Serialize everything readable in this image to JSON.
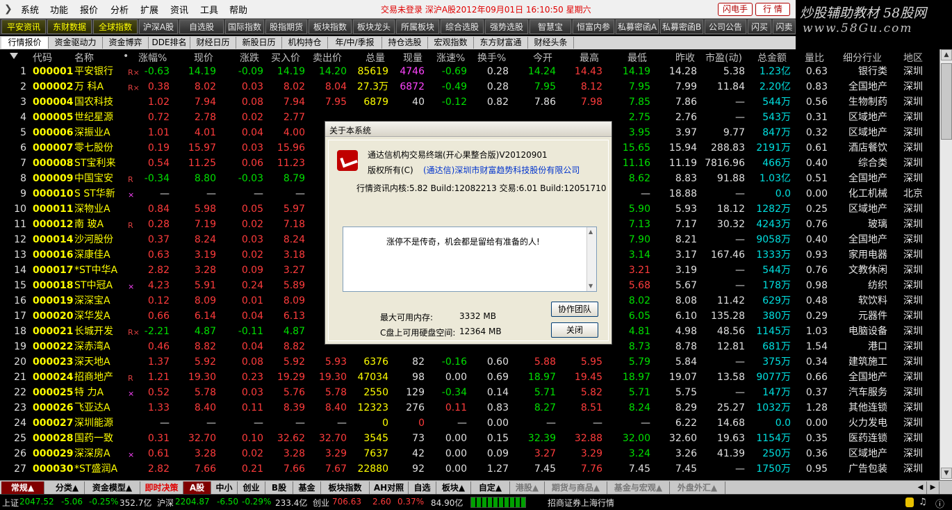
{
  "menubar": {
    "items": [
      "系统",
      "功能",
      "报价",
      "分析",
      "扩展",
      "资讯",
      "工具",
      "帮助"
    ],
    "status": "交易未登录   深沪A股2012年09月01日  16:10:50  星期六",
    "btn_dial": "闪电手",
    "btn_quote": "行  情"
  },
  "logo": {
    "line1": "炒股辅助教材 58股网",
    "line2": "www.58Gu.com"
  },
  "toolbar": {
    "buttons": [
      "平安资讯",
      "东财数据",
      "全球指数",
      "沪深A股",
      "自选股",
      "国际指数",
      "股指期货",
      "板块指数",
      "板块龙头",
      "所属板块",
      "综合选股",
      "强势选股",
      "智慧宝",
      "恒富内参",
      "私募密函A",
      "私募密函B",
      "公司公告",
      "闪买",
      "闪卖"
    ]
  },
  "tabbar": {
    "tabs": [
      "行情报价",
      "资金驱动力",
      "资金博弈",
      "DDE排名",
      "财经日历",
      "新股日历",
      "机构持仓",
      "年/中/季报",
      "持仓选股",
      "宏观指数",
      "东方财富通",
      "财经头条"
    ]
  },
  "table": {
    "headers": [
      "代码",
      "名称",
      "•",
      "涨幅%",
      "现价",
      "涨跌",
      "买入价",
      "卖出价",
      "总量",
      "现量",
      "涨速%",
      "换手%",
      "今开",
      "最高",
      "最低",
      "昨收",
      "市盈(动)",
      "总金额",
      "量比",
      "细分行业",
      "地区"
    ],
    "rows": [
      [
        "1",
        "000001",
        "平安银行",
        "R×",
        "-0.63",
        "14.19",
        "-0.09",
        "14.19",
        "14.20",
        "85619",
        "4746",
        "-0.69",
        "0.28",
        "14.24",
        "14.43",
        "14.19",
        "14.28",
        "5.38",
        "1.23亿",
        "0.63",
        "银行类",
        "深圳"
      ],
      [
        "2",
        "000002",
        "万  科A",
        "R×",
        "0.38",
        "8.02",
        "0.03",
        "8.02",
        "8.04",
        "27.3万",
        "6872",
        "-0.49",
        "0.28",
        "7.95",
        "8.12",
        "7.95",
        "7.99",
        "11.84",
        "2.20亿",
        "0.83",
        "全国地产",
        "深圳"
      ],
      [
        "3",
        "000004",
        "国农科技",
        "",
        "1.02",
        "7.94",
        "0.08",
        "7.94",
        "7.95",
        "6879",
        "40",
        "-0.12",
        "0.82",
        "7.86",
        "7.98",
        "7.85",
        "7.86",
        "—",
        "544万",
        "0.56",
        "生物制药",
        "深圳"
      ],
      [
        "4",
        "000005",
        "世纪星源",
        "",
        "0.72",
        "2.78",
        "0.02",
        "2.77",
        "",
        "",
        "",
        "",
        "",
        "",
        "",
        "2.75",
        "2.76",
        "—",
        "543万",
        "0.31",
        "区域地产",
        "深圳"
      ],
      [
        "5",
        "000006",
        "深振业A",
        "",
        "1.01",
        "4.01",
        "0.04",
        "4.00",
        "",
        "",
        "",
        "",
        "",
        "",
        "",
        "3.95",
        "3.97",
        "9.77",
        "847万",
        "0.32",
        "区域地产",
        "深圳"
      ],
      [
        "6",
        "000007",
        "零七股份",
        "",
        "0.19",
        "15.97",
        "0.03",
        "15.96",
        "",
        "",
        "",
        "",
        "",
        "",
        "",
        "15.65",
        "15.94",
        "288.83",
        "2191万",
        "0.61",
        "酒店餐饮",
        "深圳"
      ],
      [
        "7",
        "000008",
        "ST宝利来",
        "",
        "0.54",
        "11.25",
        "0.06",
        "11.23",
        "",
        "",
        "",
        "",
        "",
        "",
        "",
        "11.16",
        "11.19",
        "7816.96",
        "466万",
        "0.40",
        "综合类",
        "深圳"
      ],
      [
        "8",
        "000009",
        "中国宝安",
        "R",
        "-0.34",
        "8.80",
        "-0.03",
        "8.79",
        "",
        "",
        "",
        "",
        "",
        "",
        "",
        "8.62",
        "8.83",
        "91.88",
        "1.03亿",
        "0.51",
        "全国地产",
        "深圳"
      ],
      [
        "9",
        "000010",
        "S ST华新",
        "×",
        "—",
        "—",
        "—",
        "—",
        "",
        "",
        "",
        "",
        "",
        "",
        "",
        "—",
        "18.88",
        "—",
        "0.0",
        "0.00",
        "化工机械",
        "北京"
      ],
      [
        "10",
        "000011",
        "深物业A",
        "",
        "0.84",
        "5.98",
        "0.05",
        "5.97",
        "",
        "",
        "",
        "",
        "",
        "",
        "",
        "5.90",
        "5.93",
        "18.12",
        "1282万",
        "0.25",
        "区域地产",
        "深圳"
      ],
      [
        "11",
        "000012",
        "南  玻A",
        "R",
        "0.28",
        "7.19",
        "0.02",
        "7.18",
        "",
        "",
        "",
        "",
        "",
        "",
        "",
        "7.13",
        "7.17",
        "30.32",
        "4243万",
        "0.76",
        "玻璃",
        "深圳"
      ],
      [
        "12",
        "000014",
        "沙河股份",
        "",
        "0.37",
        "8.24",
        "0.03",
        "8.24",
        "",
        "",
        "",
        "",
        "",
        "",
        "",
        "7.90",
        "8.21",
        "—",
        "9058万",
        "0.40",
        "全国地产",
        "深圳"
      ],
      [
        "13",
        "000016",
        "深康佳A",
        "",
        "0.63",
        "3.19",
        "0.02",
        "3.18",
        "",
        "",
        "",
        "",
        "",
        "",
        "",
        "3.14",
        "3.17",
        "167.46",
        "1333万",
        "0.93",
        "家用电器",
        "深圳"
      ],
      [
        "14",
        "000017",
        "*ST中华A",
        "",
        "2.82",
        "3.28",
        "0.09",
        "3.27",
        "",
        "",
        "",
        "",
        "",
        "",
        "",
        "3.21",
        "3.19",
        "—",
        "544万",
        "0.76",
        "文教休闲",
        "深圳"
      ],
      [
        "15",
        "000018",
        "ST中冠A",
        "×",
        "4.23",
        "5.91",
        "0.24",
        "5.89",
        "",
        "",
        "",
        "",
        "",
        "",
        "",
        "5.68",
        "5.67",
        "—",
        "178万",
        "0.98",
        "纺织",
        "深圳"
      ],
      [
        "16",
        "000019",
        "深深宝A",
        "",
        "0.12",
        "8.09",
        "0.01",
        "8.09",
        "",
        "",
        "",
        "",
        "",
        "",
        "",
        "8.02",
        "8.08",
        "11.42",
        "629万",
        "0.48",
        "软饮料",
        "深圳"
      ],
      [
        "17",
        "000020",
        "深华发A",
        "",
        "0.66",
        "6.14",
        "0.04",
        "6.13",
        "",
        "",
        "",
        "",
        "",
        "",
        "",
        "6.05",
        "6.10",
        "135.28",
        "380万",
        "0.29",
        "元器件",
        "深圳"
      ],
      [
        "18",
        "000021",
        "长城开发",
        "R×",
        "-2.21",
        "4.87",
        "-0.11",
        "4.87",
        "",
        "",
        "",
        "",
        "",
        "",
        "",
        "4.81",
        "4.98",
        "48.56",
        "1145万",
        "1.03",
        "电脑设备",
        "深圳"
      ],
      [
        "19",
        "000022",
        "深赤湾A",
        "",
        "0.46",
        "8.82",
        "0.04",
        "8.82",
        "",
        "",
        "",
        "",
        "",
        "",
        "",
        "8.73",
        "8.78",
        "12.81",
        "681万",
        "1.54",
        "港口",
        "深圳"
      ],
      [
        "20",
        "000023",
        "深天地A",
        "",
        "1.37",
        "5.92",
        "0.08",
        "5.92",
        "5.93",
        "6376",
        "82",
        "-0.16",
        "0.60",
        "5.88",
        "5.95",
        "5.79",
        "5.84",
        "—",
        "375万",
        "0.34",
        "建筑施工",
        "深圳"
      ],
      [
        "21",
        "000024",
        "招商地产",
        "R",
        "1.21",
        "19.30",
        "0.23",
        "19.29",
        "19.30",
        "47034",
        "98",
        "0.00",
        "0.69",
        "18.97",
        "19.45",
        "18.97",
        "19.07",
        "13.58",
        "9077万",
        "0.66",
        "全国地产",
        "深圳"
      ],
      [
        "22",
        "000025",
        "特  力A",
        "×",
        "0.52",
        "5.78",
        "0.03",
        "5.76",
        "5.78",
        "2550",
        "129",
        "-0.34",
        "0.14",
        "5.71",
        "5.82",
        "5.71",
        "5.75",
        "—",
        "147万",
        "0.37",
        "汽车服务",
        "深圳"
      ],
      [
        "23",
        "000026",
        "飞亚达A",
        "",
        "1.33",
        "8.40",
        "0.11",
        "8.39",
        "8.40",
        "12323",
        "276",
        "0.11",
        "0.83",
        "8.27",
        "8.51",
        "8.24",
        "8.29",
        "25.27",
        "1032万",
        "1.28",
        "其他连锁",
        "深圳"
      ],
      [
        "24",
        "000027",
        "深圳能源",
        "",
        "—",
        "—",
        "—",
        "—",
        "—",
        "0",
        "0",
        "—",
        "0.00",
        "—",
        "—",
        "—",
        "6.22",
        "14.68",
        "0.0",
        "0.00",
        "火力发电",
        "深圳"
      ],
      [
        "25",
        "000028",
        "国药一致",
        "",
        "0.31",
        "32.70",
        "0.10",
        "32.62",
        "32.70",
        "3545",
        "73",
        "0.00",
        "0.15",
        "32.39",
        "32.88",
        "32.00",
        "32.60",
        "19.63",
        "1154万",
        "0.35",
        "医药连锁",
        "深圳"
      ],
      [
        "26",
        "000029",
        "深深房A",
        "×",
        "0.61",
        "3.28",
        "0.02",
        "3.28",
        "3.29",
        "7637",
        "42",
        "0.00",
        "0.09",
        "3.27",
        "3.29",
        "3.24",
        "3.26",
        "41.39",
        "250万",
        "0.36",
        "区域地产",
        "深圳"
      ],
      [
        "27",
        "000030",
        "*ST盛润A",
        "",
        "2.82",
        "7.66",
        "0.21",
        "7.66",
        "7.67",
        "22880",
        "92",
        "0.00",
        "1.27",
        "7.45",
        "7.76",
        "7.45",
        "7.45",
        "—",
        "1750万",
        "0.95",
        "广告包装",
        "深圳"
      ]
    ]
  },
  "bottom_tabs": [
    "常规▲",
    "分类▲",
    "资金模型▲",
    "即时决策",
    "A股",
    "中小",
    "创业",
    "B股",
    "基金",
    "板块指数",
    "AH对照",
    "自选",
    "板块▲",
    "自定▲",
    "港股▲",
    "期货与商品▲",
    "基金与宏观▲",
    "外盘外汇▲"
  ],
  "statusbar": {
    "sh_label": "上证",
    "sh_val": "2047.52",
    "sh_chg": "-5.06",
    "sh_pct": "-0.25%",
    "sh_amt": "352.7亿",
    "sz_label": "沪深",
    "sz_val": "2204.87",
    "sz_chg": "-6.50",
    "sz_pct": "-0.29%",
    "sz_amt": "233.4亿",
    "cy_label": "创业",
    "cy_val": "706.63",
    "cy_chg": "2.60",
    "cy_pct": "0.37%",
    "cy_amt": "84.90亿",
    "broker": "招商证券上海行情"
  },
  "dialog": {
    "title": "关于本系统",
    "product": "通达信机构交易终端(开心果整合版)V20120901",
    "copyright_label": "版权所有(C)",
    "company": "(通达信)深圳市财富趋势科技股份有限公司",
    "build": "行情资讯内核:5.82 Build:12082213 交易:6.01 Build:12051710",
    "message": "涨停不是传奇，机会都是留给有准备的人!",
    "mem_label": "最大可用内存:",
    "mem_val": "3332 MB",
    "disk_label": "C盘上可用硬盘空间:",
    "disk_val": "12364 MB",
    "btn_team": "协作团队",
    "btn_close": "关闭"
  },
  "colors": {
    "up": "#ff3c3c",
    "down": "#00e000",
    "code": "#ffff00",
    "amount": "#00e0e0",
    "background": "#000000"
  }
}
